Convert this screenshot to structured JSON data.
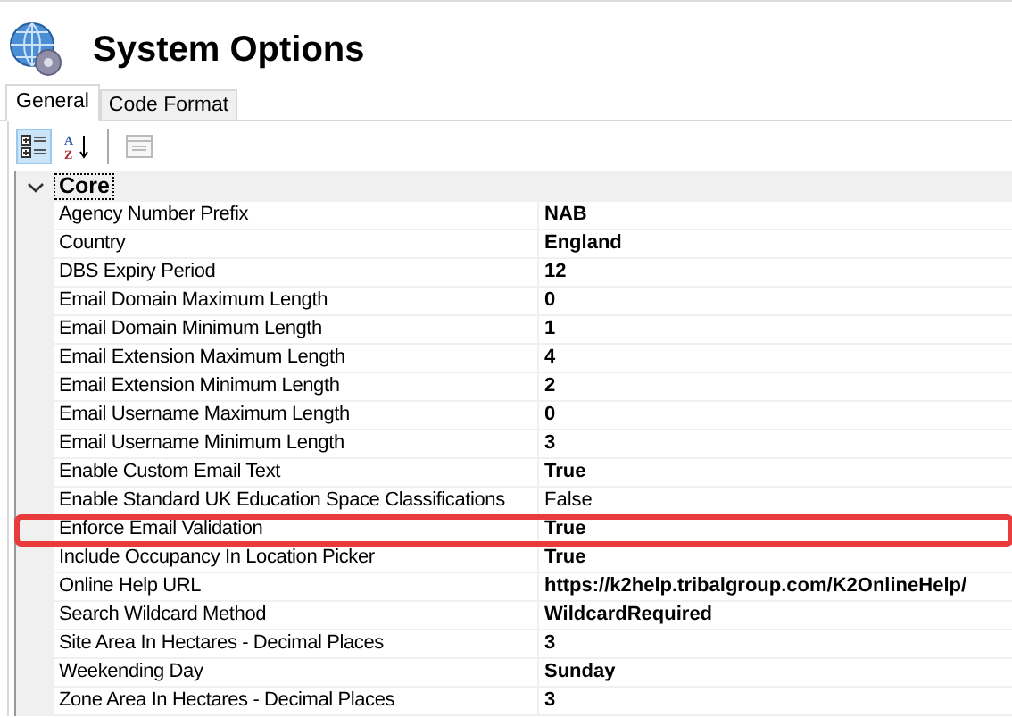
{
  "window": {
    "title": "System Options"
  },
  "tabs": [
    {
      "label": "General",
      "selected": true
    },
    {
      "label": "Code Format",
      "selected": false
    }
  ],
  "toolbar": [
    {
      "kind": "categorized",
      "selected": true,
      "disabled": false
    },
    {
      "kind": "alphabetical",
      "selected": false,
      "disabled": false,
      "letters": [
        "A",
        "Z"
      ]
    },
    {
      "kind": "pages",
      "selected": false,
      "disabled": true
    }
  ],
  "category": {
    "label": "Core",
    "expanded": true
  },
  "rows": [
    {
      "name": "Agency Number Prefix",
      "value": "NAB",
      "bold": true,
      "highlighted": false
    },
    {
      "name": "Country",
      "value": "England",
      "bold": true,
      "highlighted": false
    },
    {
      "name": "DBS Expiry Period",
      "value": "12",
      "bold": true,
      "highlighted": false
    },
    {
      "name": "Email Domain Maximum Length",
      "value": "0",
      "bold": true,
      "highlighted": false
    },
    {
      "name": "Email Domain Minimum Length",
      "value": "1",
      "bold": true,
      "highlighted": false
    },
    {
      "name": "Email Extension Maximum Length",
      "value": "4",
      "bold": true,
      "highlighted": false
    },
    {
      "name": "Email Extension Minimum Length",
      "value": "2",
      "bold": true,
      "highlighted": false
    },
    {
      "name": "Email Username Maximum Length",
      "value": "0",
      "bold": true,
      "highlighted": false
    },
    {
      "name": "Email Username Minimum Length",
      "value": "3",
      "bold": true,
      "highlighted": false
    },
    {
      "name": "Enable Custom Email Text",
      "value": "True",
      "bold": true,
      "highlighted": false
    },
    {
      "name": "Enable Standard UK Education Space Classifications",
      "value": "False",
      "bold": false,
      "highlighted": false
    },
    {
      "name": "Enforce Email Validation",
      "value": "True",
      "bold": true,
      "highlighted": true
    },
    {
      "name": "Include Occupancy In Location Picker",
      "value": "True",
      "bold": true,
      "highlighted": false
    },
    {
      "name": "Online Help URL",
      "value": "https://k2help.tribalgroup.com/K2OnlineHelp/",
      "bold": true,
      "highlighted": false
    },
    {
      "name": "Search Wildcard Method",
      "value": "WildcardRequired",
      "bold": true,
      "highlighted": false
    },
    {
      "name": "Site Area In Hectares - Decimal Places",
      "value": "3",
      "bold": true,
      "highlighted": false
    },
    {
      "name": "Weekending Day",
      "value": "Sunday",
      "bold": true,
      "highlighted": false
    },
    {
      "name": "Zone Area In Hectares - Decimal Places",
      "value": "3",
      "bold": true,
      "highlighted": false
    }
  ]
}
